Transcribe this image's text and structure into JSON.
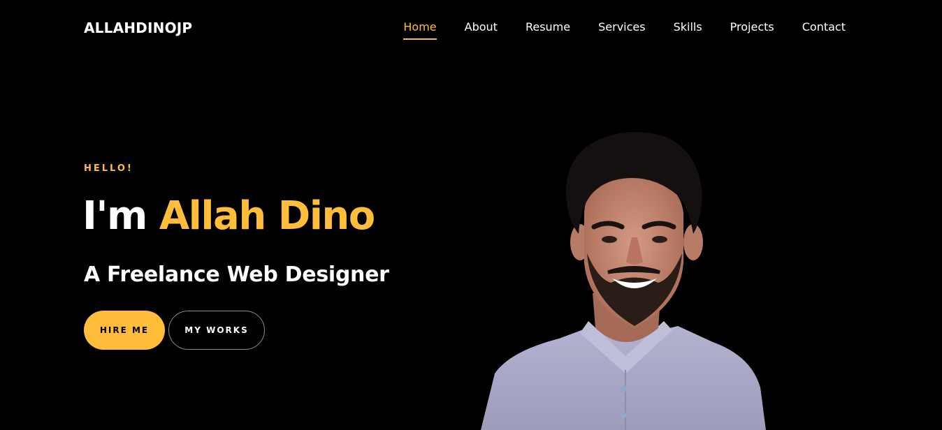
{
  "navbar": {
    "brand": "ALLAHDINOJP",
    "links": [
      {
        "label": "Home",
        "active": true
      },
      {
        "label": "About",
        "active": false
      },
      {
        "label": "Resume",
        "active": false
      },
      {
        "label": "Services",
        "active": false
      },
      {
        "label": "Skills",
        "active": false
      },
      {
        "label": "Projects",
        "active": false
      },
      {
        "label": "Contact",
        "active": false
      }
    ]
  },
  "hero": {
    "greeting": "HELLO!",
    "headline_prefix": "I'm ",
    "headline_name": "Allah Dino",
    "subtitle": "A Freelance Web Designer",
    "buttons": {
      "hire_label": "HIRE ME",
      "works_label": "MY WORKS"
    }
  },
  "colors": {
    "accent": "#ffbd39",
    "background": "#000000",
    "text": "#ffffff"
  },
  "icons": {
    "portrait": "profile-photo"
  }
}
